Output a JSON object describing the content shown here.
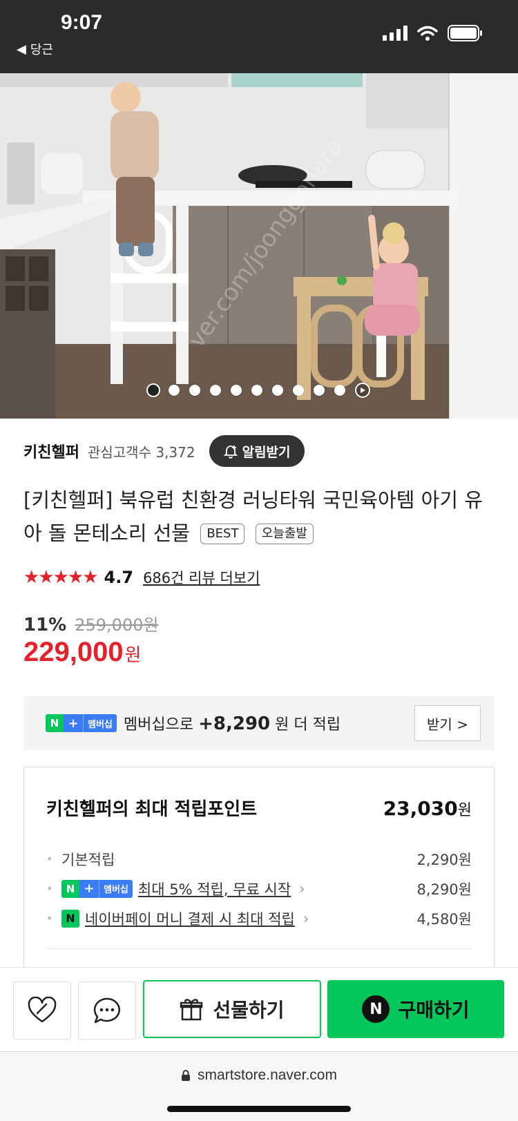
{
  "status_bar": {
    "time": "9:07",
    "back_label": "당근",
    "icons": [
      "signal-icon",
      "wifi-icon",
      "battery-icon"
    ]
  },
  "hero": {
    "slide_count": 11,
    "active_index": 0,
    "play_index": 10
  },
  "store": {
    "name": "키친헬퍼",
    "followers": "관심고객수 3,372",
    "alarm_label": "알림받기"
  },
  "product": {
    "title": "[키친헬퍼] 북유럽 친환경 러닝타워 국민육아템 아기 유아 돌 몬테소리 선물",
    "badges": [
      "BEST",
      "오늘출발"
    ],
    "rating_value": 4.7,
    "rating_text": "4.7",
    "reviews_link": "686건 리뷰 더보기",
    "discount": "11%",
    "original_price": "259,000원",
    "price": "229,000",
    "price_unit": "원"
  },
  "membership": {
    "n_label": "N",
    "plus_label": "+",
    "badge_label": "멤버십",
    "text_prefix": "멤버십으로",
    "amount": "+8,290",
    "text_suffix": "원 더 적립",
    "button_label": "받기 >"
  },
  "points": {
    "title": "키친헬퍼의 최대 적립포인트",
    "total": "23,030",
    "total_unit": "원",
    "rows": [
      {
        "label": "기본적립",
        "amount": "2,290원"
      },
      {
        "label": "최대 5% 적립, 무료 시작",
        "amount": "8,290원"
      },
      {
        "label": "네이버페이 머니 결제 시 최대 적립",
        "amount": "4,580원"
      }
    ]
  },
  "bottom_bar": {
    "gift_label": "선물하기",
    "buy_label": "구매하기",
    "buy_icon_letter": "N"
  },
  "url_bar": {
    "url": "smartstore.naver.com"
  },
  "colors": {
    "accent_green": "#03c75a",
    "price_red": "#e4222b",
    "membership_blue": "#3a7bf7"
  }
}
